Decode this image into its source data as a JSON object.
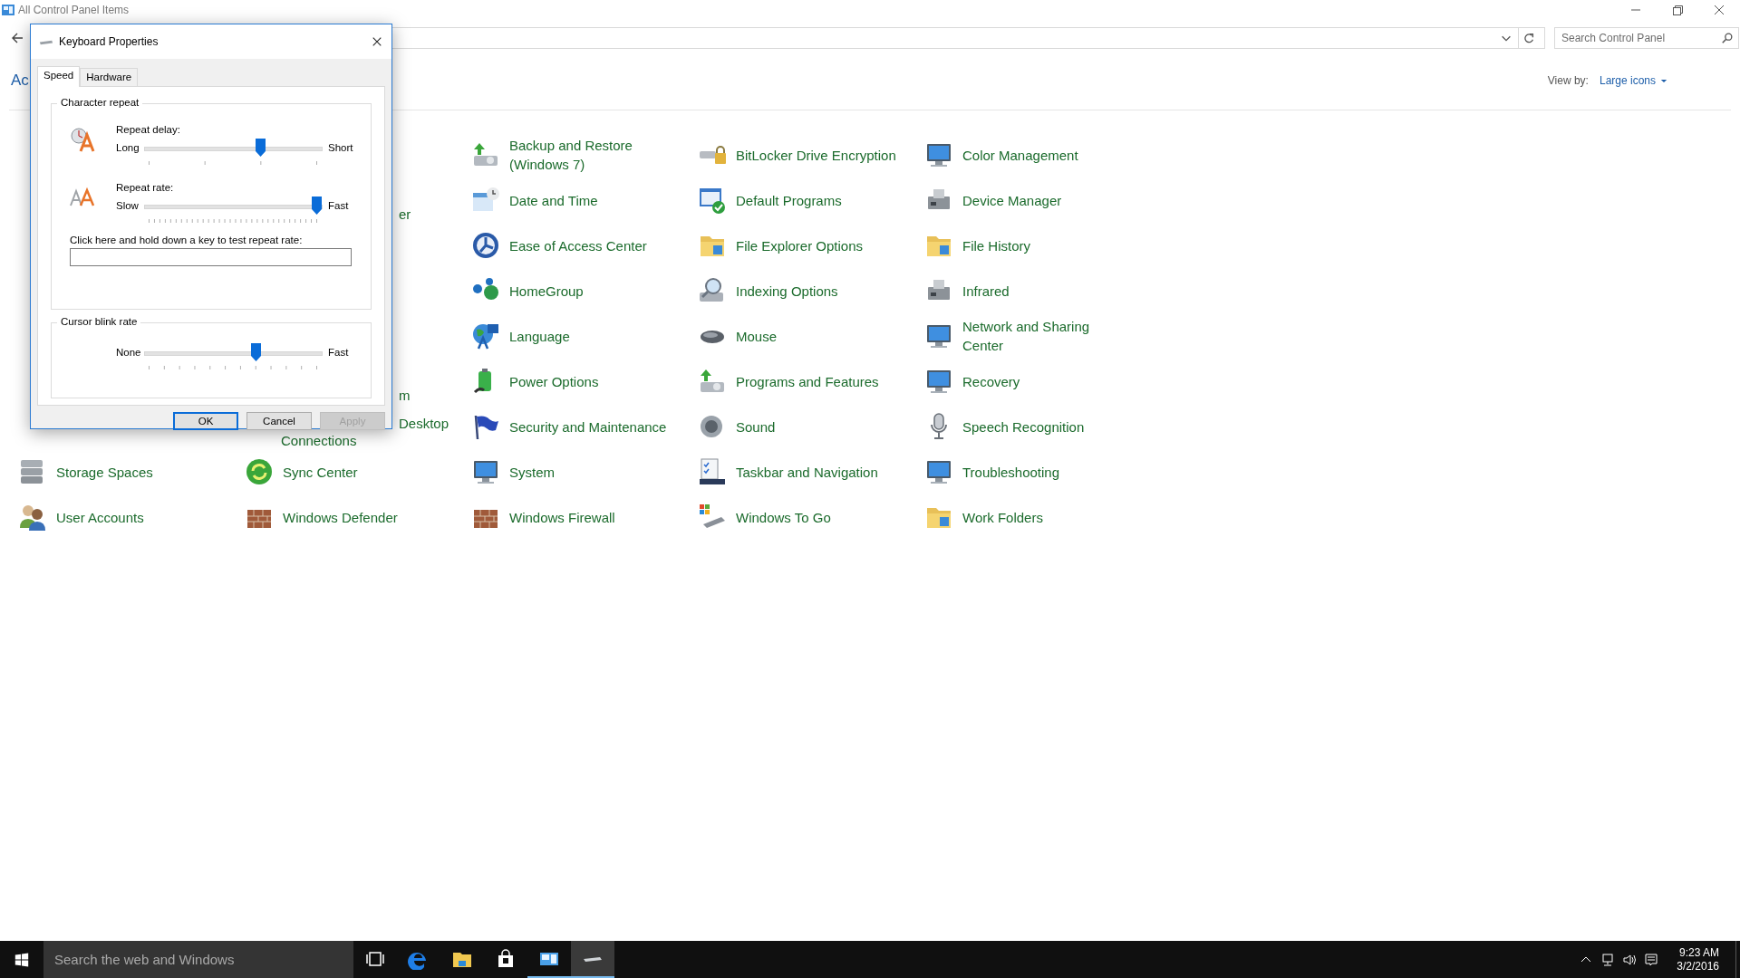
{
  "window": {
    "title": "All Control Panel Items",
    "search": {
      "placeholder": "Search Control Panel"
    },
    "heading": "Ac",
    "view_by": {
      "label": "View by:",
      "value": "Large icons"
    }
  },
  "rows": [
    {
      "cells": [
        {
          "kind": "full",
          "lines": [
            "Backup and Restore",
            "(Windows 7)"
          ]
        },
        {
          "kind": "full",
          "lines": [
            "BitLocker Drive Encryption"
          ]
        },
        {
          "kind": "full",
          "lines": [
            "Color Management"
          ]
        }
      ]
    },
    {
      "cells": [
        {
          "kind": "clipped",
          "lines": [
            "er"
          ]
        },
        {
          "kind": "full",
          "lines": [
            "Date and Time"
          ]
        },
        {
          "kind": "full",
          "lines": [
            "Default Programs"
          ]
        },
        {
          "kind": "full",
          "lines": [
            "Device Manager"
          ]
        }
      ]
    },
    {
      "cells": [
        {
          "kind": "full",
          "lines": [
            "Ease of Access Center"
          ]
        },
        {
          "kind": "full",
          "lines": [
            "File Explorer Options"
          ]
        },
        {
          "kind": "full",
          "lines": [
            "File History"
          ]
        }
      ]
    },
    {
      "cells": [
        {
          "kind": "full",
          "lines": [
            "HomeGroup"
          ]
        },
        {
          "kind": "full",
          "lines": [
            "Indexing Options"
          ]
        },
        {
          "kind": "full",
          "lines": [
            "Infrared"
          ]
        }
      ]
    },
    {
      "cells": [
        {
          "kind": "full",
          "lines": [
            "Language"
          ]
        },
        {
          "kind": "full",
          "lines": [
            "Mouse"
          ]
        },
        {
          "kind": "full",
          "lines": [
            "Network and Sharing",
            "Center"
          ]
        }
      ]
    },
    {
      "cells": [
        {
          "kind": "clipped",
          "lines": [
            "m"
          ]
        },
        {
          "kind": "full",
          "lines": [
            "Power Options"
          ]
        },
        {
          "kind": "full",
          "lines": [
            "Programs and Features"
          ]
        },
        {
          "kind": "full",
          "lines": [
            "Recovery"
          ]
        }
      ]
    },
    {
      "cells": [
        {
          "kind": "clipped",
          "lines": [
            "Desktop",
            "Connections"
          ]
        },
        {
          "kind": "full",
          "lines": [
            "Security and Maintenance"
          ]
        },
        {
          "kind": "full",
          "lines": [
            "Sound"
          ]
        },
        {
          "kind": "full",
          "lines": [
            "Speech Recognition"
          ]
        }
      ]
    },
    {
      "cells": [
        {
          "kind": "full",
          "lines": [
            "Storage Spaces"
          ]
        },
        {
          "kind": "full",
          "lines": [
            "Sync Center"
          ]
        },
        {
          "kind": "full",
          "lines": [
            "System"
          ]
        },
        {
          "kind": "full",
          "lines": [
            "Taskbar and Navigation"
          ]
        },
        {
          "kind": "full",
          "lines": [
            "Troubleshooting"
          ]
        }
      ]
    },
    {
      "cells": [
        {
          "kind": "full",
          "lines": [
            "User Accounts"
          ]
        },
        {
          "kind": "full",
          "lines": [
            "Windows Defender"
          ]
        },
        {
          "kind": "full",
          "lines": [
            "Windows Firewall"
          ]
        },
        {
          "kind": "full",
          "lines": [
            "Windows To Go"
          ]
        },
        {
          "kind": "full",
          "lines": [
            "Work Folders"
          ]
        }
      ]
    }
  ],
  "dialog": {
    "title": "Keyboard Properties",
    "tabs": [
      {
        "label": "Speed",
        "selected": true
      },
      {
        "label": "Hardware",
        "selected": false
      }
    ],
    "groups": [
      {
        "title": "Character repeat",
        "sliders": [
          {
            "kind": "delay",
            "label": "Repeat delay:",
            "min_label": "Long",
            "max_label": "Short",
            "level": 0.667
          },
          {
            "kind": "rate",
            "label": "Repeat rate:",
            "min_label": "Slow",
            "max_label": "Fast",
            "level": 1
          }
        ],
        "test_prompt": "Click here and hold down a key to test repeat rate:"
      },
      {
        "title": "Cursor blink rate",
        "sliders": [
          {
            "kind": "blink",
            "min_label": "None",
            "max_label": "Fast",
            "level": 0.636
          }
        ]
      }
    ],
    "buttons": [
      {
        "label": "OK",
        "default": true,
        "disabled": false
      },
      {
        "label": "Cancel",
        "default": false,
        "disabled": false
      },
      {
        "label": "Apply",
        "default": false,
        "disabled": true
      }
    ]
  },
  "taskbar": {
    "search_placeholder": "Search the web and Windows",
    "apps": [
      {
        "open": false,
        "selected": false
      },
      {
        "open": false,
        "selected": false
      },
      {
        "open": false,
        "selected": false
      },
      {
        "open": false,
        "selected": false
      },
      {
        "open": true,
        "selected": false
      },
      {
        "open": true,
        "selected": true
      }
    ],
    "time": "9:23 AM",
    "date": "3/2/2016"
  }
}
